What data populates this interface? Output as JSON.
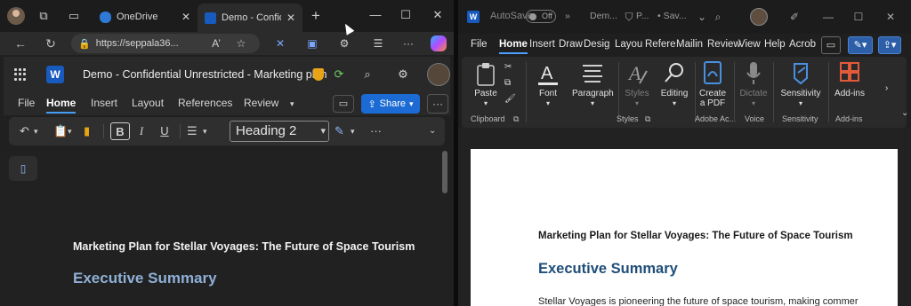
{
  "edge": {
    "tabs": [
      {
        "title": "OneDrive",
        "active": false
      },
      {
        "title": "Demo - Confide",
        "active": true
      }
    ],
    "new_tab": "+",
    "window_controls": {
      "minimize": "—",
      "maximize": "☐",
      "close": "✕"
    },
    "address": {
      "url": "https://seppala36...",
      "read_aloud": "A’"
    },
    "word_online": {
      "logo_letter": "W",
      "doc_title": "Demo - Confidential Unrestricted - Marketing plan",
      "menu": [
        "File",
        "Home",
        "Insert",
        "Layout",
        "References",
        "Review"
      ],
      "selected_menu": "Home",
      "share_label": "Share",
      "more_label": "···",
      "style_value": "Heading 2",
      "format_buttons": {
        "bold": "B",
        "italic": "I",
        "underline": "U"
      },
      "ellipsis": "···"
    },
    "document": {
      "heading": "Marketing Plan for Stellar Voyages: The Future of Space Tourism",
      "section": "Executive Summary"
    }
  },
  "word": {
    "logo_letter": "W",
    "autosave": {
      "label": "AutoSave",
      "state": "Off"
    },
    "title_snippet": "Dem...",
    "sensitivity_snippet": "P...",
    "save_snippet": "• Sav...",
    "chevrons": "»",
    "menu": [
      "File",
      "Home",
      "Insert",
      "Draw",
      "Design",
      "Layout",
      "References",
      "Mailings",
      "Review",
      "View",
      "Help",
      "Acrobat"
    ],
    "menu_display": [
      "File",
      "Home",
      "Insert",
      "Draw",
      "Desig",
      "Layou",
      "Refere",
      "Mailin",
      "Review",
      "View",
      "Help",
      "Acrob"
    ],
    "selected_menu": "Home",
    "ribbon": {
      "paste": "Paste",
      "font": "Font",
      "paragraph": "Paragraph",
      "styles": "Styles",
      "editing": "Editing",
      "create_pdf_1": "Create",
      "create_pdf_2": "a PDF",
      "dictate": "Dictate",
      "sensitivity": "Sensitivity",
      "addins": "Add-ins",
      "groups": {
        "clipboard": "Clipboard",
        "styles": "Styles",
        "adobe": "Adobe Ac...",
        "voice": "Voice",
        "sensitivity": "Sensitivity",
        "addins": "Add-ins"
      }
    },
    "page": {
      "heading": "Marketing Plan for Stellar Voyages: The Future of Space Tourism",
      "section": "Executive Summary",
      "body": "Stellar Voyages is pioneering the future of space tourism, making commer"
    }
  },
  "colors": {
    "accent": "#479ef5",
    "share_blue": "#1c6bd4",
    "word_blue": "#185abd",
    "heading_blue_dark": "#1f4e79",
    "heading_blue_light": "#8fb0d6"
  },
  "icons": [
    "avatar-icon",
    "workspaces-icon",
    "tab-actions-icon",
    "onedrive-icon",
    "word-icon",
    "back-icon",
    "refresh-icon",
    "lock-icon",
    "read-aloud-icon",
    "favorite-icon",
    "extensions-icon",
    "copilot-icon",
    "waffle-icon",
    "shield-icon",
    "settings-icon",
    "search-icon"
  ]
}
